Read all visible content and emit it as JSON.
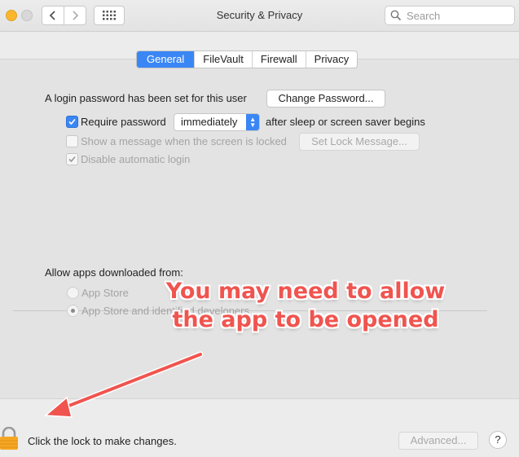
{
  "window": {
    "title": "Security & Privacy",
    "search_placeholder": "Search"
  },
  "tabs": [
    {
      "label": "General",
      "active": true
    },
    {
      "label": "FileVault",
      "active": false
    },
    {
      "label": "Firewall",
      "active": false
    },
    {
      "label": "Privacy",
      "active": false
    }
  ],
  "general": {
    "login_password_text": "A login password has been set for this user",
    "change_password_label": "Change Password...",
    "require_password_label": "Require password",
    "require_password_checked": true,
    "require_password_select": "immediately",
    "after_sleep_text": "after sleep or screen saver begins",
    "show_message_label": "Show a message when the screen is locked",
    "set_lock_message_label": "Set Lock Message...",
    "disable_auto_login_label": "Disable automatic login"
  },
  "allow_apps": {
    "heading": "Allow apps downloaded from:",
    "option_app_store": "App Store",
    "option_identified": "App Store and identified developers"
  },
  "annotation": {
    "line1": "You may need to allow",
    "line2": "the app to be opened",
    "color": "#f0544f"
  },
  "footer": {
    "lock_text": "Click the lock to make changes.",
    "advanced_label": "Advanced...",
    "help_label": "?"
  },
  "colors": {
    "accent": "#3a86f5",
    "close_button": "#fcb62c",
    "lock": "#f5a623"
  }
}
